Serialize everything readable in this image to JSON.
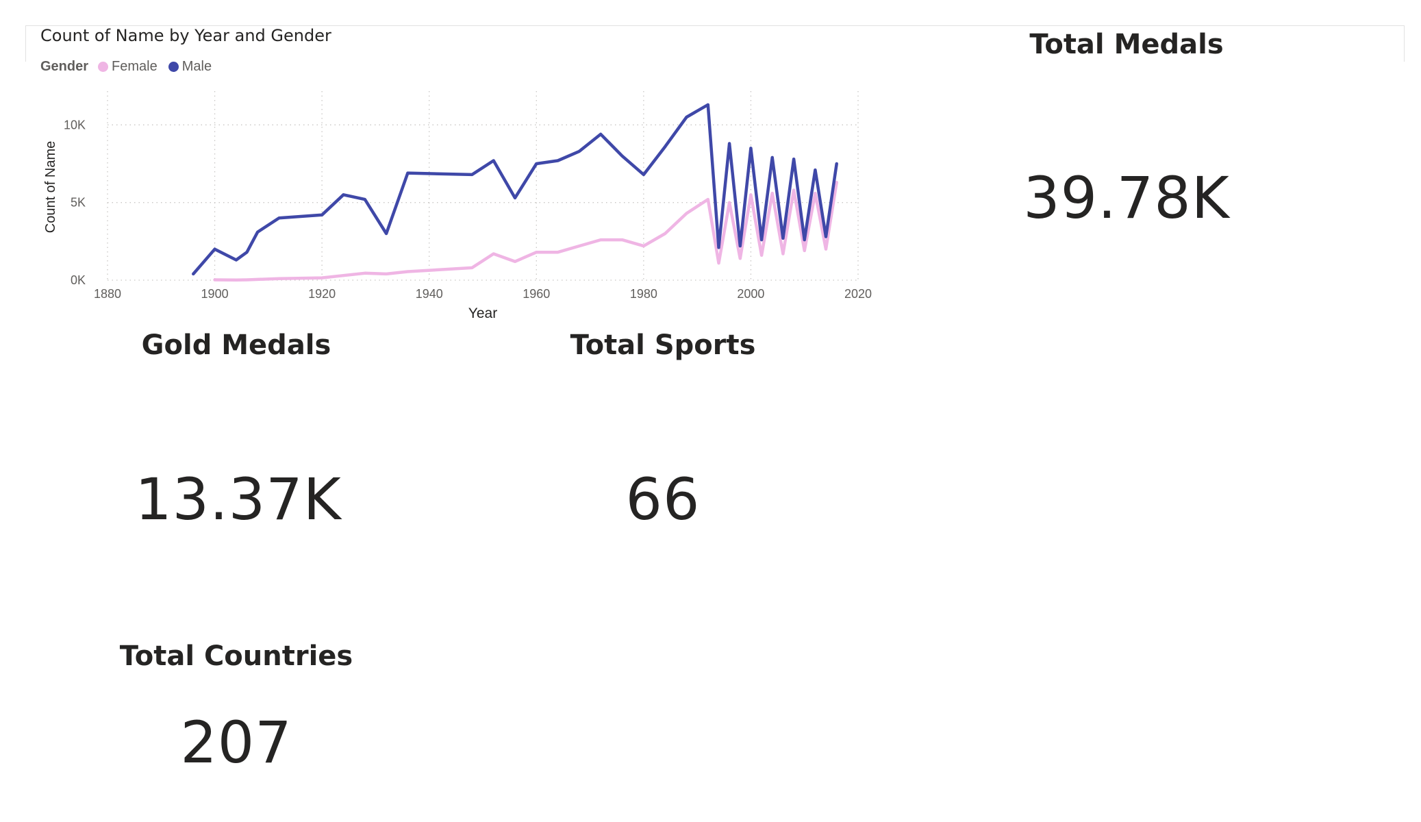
{
  "chart_data": {
    "type": "line",
    "title": "Count of Name by Year and Gender",
    "xlabel": "Year",
    "ylabel": "Count of Name",
    "legend_title": "Gender",
    "legend_position": "top-left",
    "grid": true,
    "xlim": [
      1880,
      2020
    ],
    "ylim": [
      0,
      12000
    ],
    "x_ticks": [
      {
        "value": 1880,
        "label": "1880"
      },
      {
        "value": 1900,
        "label": "1900"
      },
      {
        "value": 1920,
        "label": "1920"
      },
      {
        "value": 1940,
        "label": "1940"
      },
      {
        "value": 1960,
        "label": "1960"
      },
      {
        "value": 1980,
        "label": "1980"
      },
      {
        "value": 2000,
        "label": "2000"
      },
      {
        "value": 2020,
        "label": "2020"
      }
    ],
    "y_ticks": [
      {
        "value": 0,
        "label": "0K"
      },
      {
        "value": 5000,
        "label": "5K"
      },
      {
        "value": 10000,
        "label": "10K"
      }
    ],
    "series": [
      {
        "name": "Female",
        "color": "#efb5e4",
        "x": [
          1900,
          1904,
          1906,
          1908,
          1912,
          1920,
          1924,
          1928,
          1932,
          1936,
          1948,
          1952,
          1956,
          1960,
          1964,
          1968,
          1972,
          1976,
          1980,
          1984,
          1988,
          1992,
          1994,
          1996,
          1998,
          2000,
          2002,
          2004,
          2006,
          2008,
          2010,
          2012,
          2014,
          2016
        ],
        "y": [
          20,
          10,
          20,
          50,
          100,
          150,
          300,
          450,
          400,
          550,
          800,
          1700,
          1200,
          1800,
          1800,
          2200,
          2600,
          2600,
          2200,
          3000,
          4300,
          5200,
          1100,
          5000,
          1400,
          5500,
          1600,
          5600,
          1700,
          5800,
          1900,
          5600,
          2000,
          6300
        ]
      },
      {
        "name": "Male",
        "color": "#3f48a8",
        "x": [
          1896,
          1900,
          1904,
          1906,
          1908,
          1912,
          1920,
          1924,
          1928,
          1932,
          1936,
          1948,
          1952,
          1956,
          1960,
          1964,
          1968,
          1972,
          1976,
          1980,
          1984,
          1988,
          1992,
          1994,
          1996,
          1998,
          2000,
          2002,
          2004,
          2006,
          2008,
          2010,
          2012,
          2014,
          2016
        ],
        "y": [
          400,
          2000,
          1300,
          1800,
          3100,
          4000,
          4200,
          5500,
          5200,
          3000,
          6900,
          6800,
          7700,
          5300,
          7500,
          7700,
          8300,
          9400,
          8000,
          6800,
          8600,
          10500,
          11300,
          2100,
          8800,
          2200,
          8500,
          2600,
          7900,
          2700,
          7800,
          2600,
          7100,
          2800,
          7500
        ]
      }
    ]
  },
  "cards": {
    "total_medals": {
      "title": "Total Medals",
      "value": "39.78K"
    },
    "gold_medals": {
      "title": "Gold Medals",
      "value": "13.37K"
    },
    "total_sports": {
      "title": "Total Sports",
      "value": "66"
    },
    "total_countries": {
      "title": "Total Countries",
      "value": "207"
    }
  }
}
